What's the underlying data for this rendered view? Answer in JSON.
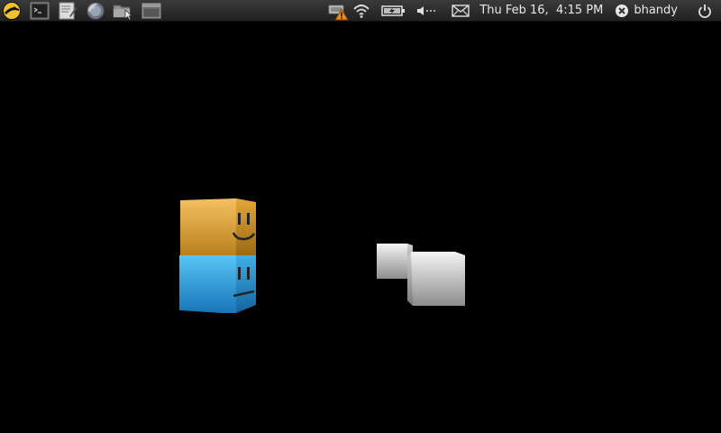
{
  "panel": {
    "launchers": [
      {
        "icon": "main-menu-icon"
      },
      {
        "icon": "terminal-icon"
      },
      {
        "icon": "text-editor-icon"
      },
      {
        "icon": "firefox-icon"
      },
      {
        "icon": "file-manager-icon"
      },
      {
        "icon": "window-icon"
      }
    ],
    "tray": {
      "network_warning_icon": "network-warning-icon",
      "wifi_icon": "wifi-icon",
      "battery_icon": "battery-icon",
      "volume_icon": "volume-icon",
      "mail_icon": "mail-icon",
      "clock": "Thu Feb 16,  4:15 PM",
      "user_status_icon": "user-status-icon",
      "username": "bhandy",
      "power_icon": "power-icon"
    }
  },
  "colors": {
    "panel_bg": "#2b2b2b",
    "desktop_bg": "#000000",
    "orange_block": "#e8a836",
    "blue_block": "#33a6e0",
    "white_block": "#e0e0e0",
    "warning": "#f08a1c"
  }
}
